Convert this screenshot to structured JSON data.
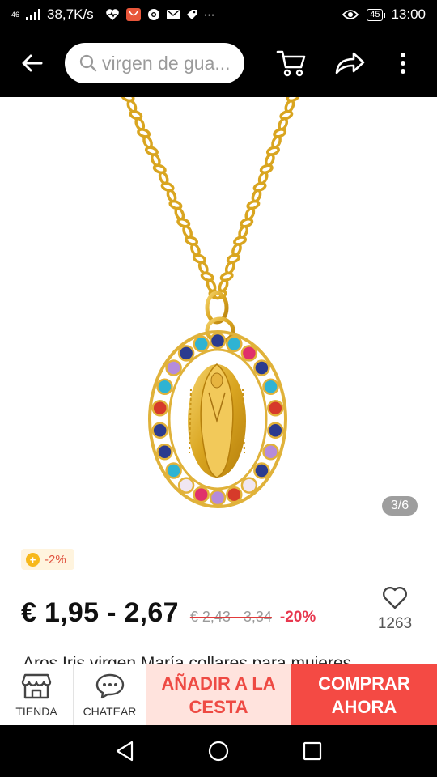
{
  "status_bar": {
    "network": "46",
    "speed": "38,7K/s",
    "battery": "45",
    "time": "13:00"
  },
  "header": {
    "search_text": "virgen de gua...",
    "icons": [
      "back-arrow-icon",
      "search-icon",
      "cart-icon",
      "share-icon",
      "more-icon"
    ]
  },
  "product": {
    "image_counter": "3/6",
    "discount_badge": "-2%",
    "price": "€ 1,95 - 2,67",
    "old_price": "€ 2,43 - 3,34",
    "discount_pct": "-20%",
    "wishlist_count": "1263",
    "title": "Aros Iris virgen María collares para mujeres"
  },
  "actions": {
    "store_label": "TIENDA",
    "chat_label": "CHATEAR",
    "add_to_cart_label": "AÑADIR A LA CESTA",
    "buy_now_label": "COMPRAR AHORA"
  },
  "colors": {
    "accent": "#f44a44",
    "cart_bg": "#ffe3dd",
    "gold": "#d4a017"
  }
}
